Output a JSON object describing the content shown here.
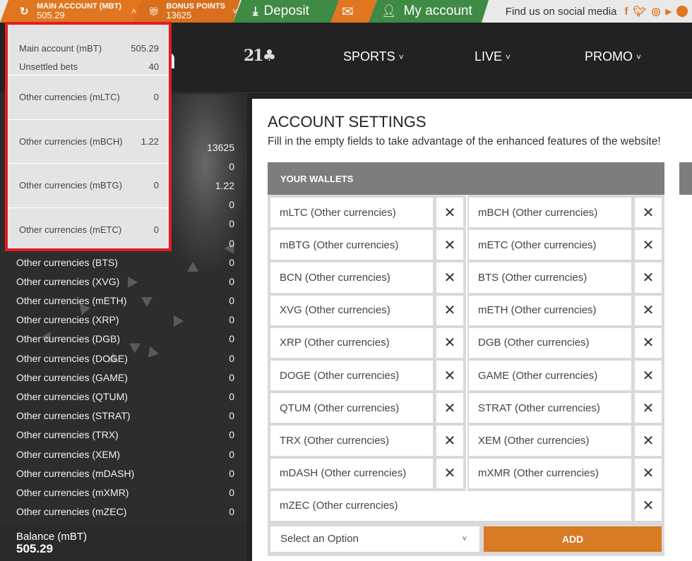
{
  "topbar": {
    "main_account_label": "MAIN ACCOUNT (mBT)",
    "main_account_value": "505.29",
    "bonus_label": "BONUS POINTS",
    "bonus_value": "13625",
    "deposit_label": "Deposit",
    "my_account_label": "My account",
    "social_label": "Find us on social media",
    "social_icons": [
      "facebook-icon",
      "twitter-icon",
      "instagram-icon",
      "youtube-icon",
      "telegram-icon"
    ]
  },
  "nav": {
    "items": [
      {
        "label": "SPORTS"
      },
      {
        "label": "LIVE"
      },
      {
        "label": "PROMO"
      }
    ]
  },
  "popup": {
    "main_label": "Main account (mBT)",
    "main_value": "505.29",
    "unsettled_label": "Unsettled bets",
    "unsettled_value": "40",
    "currencies": [
      {
        "label": "Other currencies (mLTC)",
        "value": "0"
      },
      {
        "label": "Other currencies (mBCH)",
        "value": "1.22"
      },
      {
        "label": "Other currencies (mBTG)",
        "value": "0"
      },
      {
        "label": "Other currencies (mETC)",
        "value": "0"
      }
    ]
  },
  "sidebar": {
    "rows": [
      {
        "label": "",
        "value": "13625"
      },
      {
        "label": "",
        "value": "0"
      },
      {
        "label": "",
        "value": "1.22"
      },
      {
        "label": "",
        "value": "0"
      },
      {
        "label": "",
        "value": "0"
      },
      {
        "label": "",
        "value": "0"
      },
      {
        "label": "Other currencies (BTS)",
        "value": "0"
      },
      {
        "label": "Other currencies (XVG)",
        "value": "0"
      },
      {
        "label": "Other currencies (mETH)",
        "value": "0"
      },
      {
        "label": "Other currencies (XRP)",
        "value": "0"
      },
      {
        "label": "Other currencies (DGB)",
        "value": "0"
      },
      {
        "label": "Other currencies (DOGE)",
        "value": "0"
      },
      {
        "label": "Other currencies (GAME)",
        "value": "0"
      },
      {
        "label": "Other currencies (QTUM)",
        "value": "0"
      },
      {
        "label": "Other currencies (STRAT)",
        "value": "0"
      },
      {
        "label": "Other currencies (TRX)",
        "value": "0"
      },
      {
        "label": "Other currencies (XEM)",
        "value": "0"
      },
      {
        "label": "Other currencies (mDASH)",
        "value": "0"
      },
      {
        "label": "Other currencies (mXMR)",
        "value": "0"
      },
      {
        "label": "Other currencies (mZEC)",
        "value": "0"
      }
    ],
    "balance_label": "Balance (mBT)",
    "balance_value": "505.29"
  },
  "main": {
    "title": "ACCOUNT SETTINGS",
    "subtitle": "Fill in the empty fields to take advantage of the enhanced features of the website!",
    "wallets_header": "YOUR WALLETS",
    "wallets": [
      "mLTC (Other currencies)",
      "mBCH (Other currencies)",
      "mBTG (Other currencies)",
      "mETC (Other currencies)",
      "BCN (Other currencies)",
      "BTS (Other currencies)",
      "XVG (Other currencies)",
      "mETH (Other currencies)",
      "XRP (Other currencies)",
      "DGB (Other currencies)",
      "DOGE (Other currencies)",
      "GAME (Other currencies)",
      "QTUM (Other currencies)",
      "STRAT (Other currencies)",
      "TRX (Other currencies)",
      "XEM (Other currencies)",
      "mDASH (Other currencies)",
      "mXMR (Other currencies)",
      "mZEC (Other currencies)"
    ],
    "select_placeholder": "Select an Option",
    "add_label": "ADD"
  },
  "colors": {
    "orange": "#e0761f",
    "green": "#3f8a45",
    "highlight_red": "#e31b23"
  }
}
